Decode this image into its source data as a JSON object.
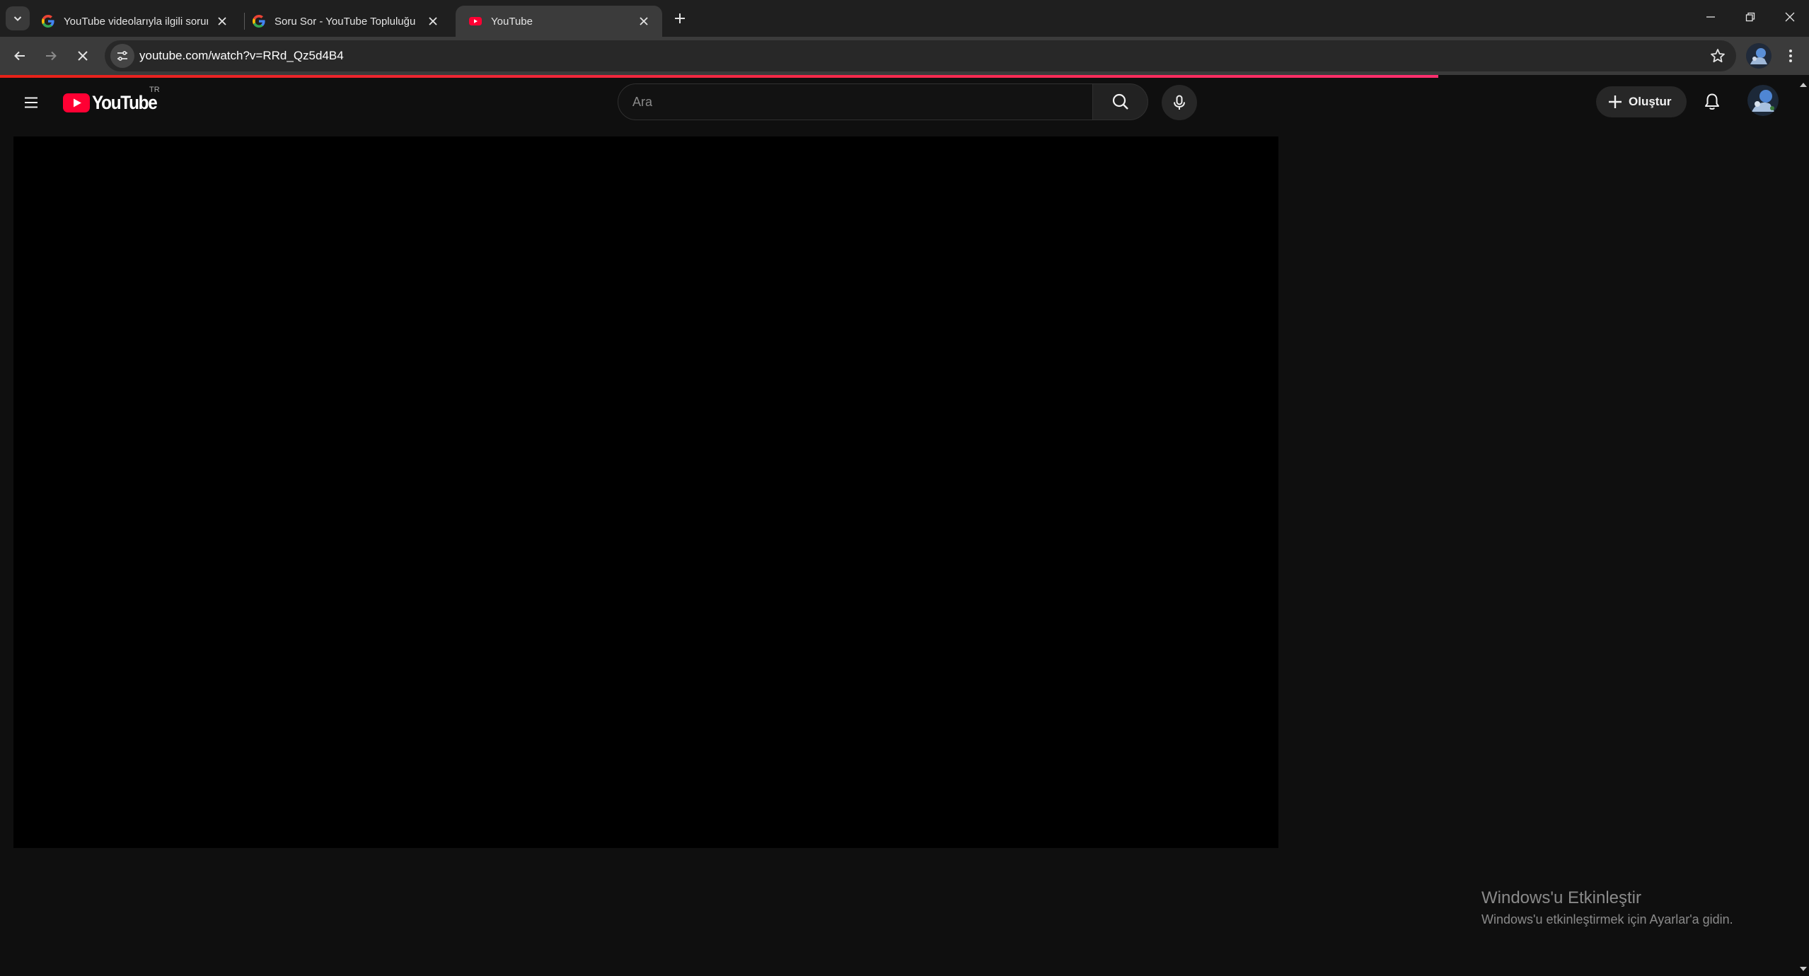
{
  "browser": {
    "tabs": [
      {
        "title": "YouTube videolarıyla ilgili sorun",
        "favicon": "google-g-icon",
        "active": false
      },
      {
        "title": "Soru Sor - YouTube Topluluğu",
        "favicon": "google-g-icon",
        "active": false
      },
      {
        "title": "YouTube",
        "favicon": "youtube-icon",
        "active": true
      }
    ],
    "url": "youtube.com/watch?v=RRd_Qz5d4B4",
    "load_progress": 0.795
  },
  "masthead": {
    "logo_text": "YouTube",
    "region": "TR",
    "search_placeholder": "Ara",
    "create_label": "Oluştur"
  },
  "watermark": {
    "title": "Windows'u Etkinleştir",
    "subtitle": "Windows'u etkinleştirmek için Ayarlar'a gidin."
  },
  "colors": {
    "page_bg": "#0f0f0f",
    "tabstrip_bg": "#1f1f1f",
    "toolbar_bg": "#3b3b3b",
    "youtube_red": "#ff0033",
    "player_bg": "#000000"
  }
}
